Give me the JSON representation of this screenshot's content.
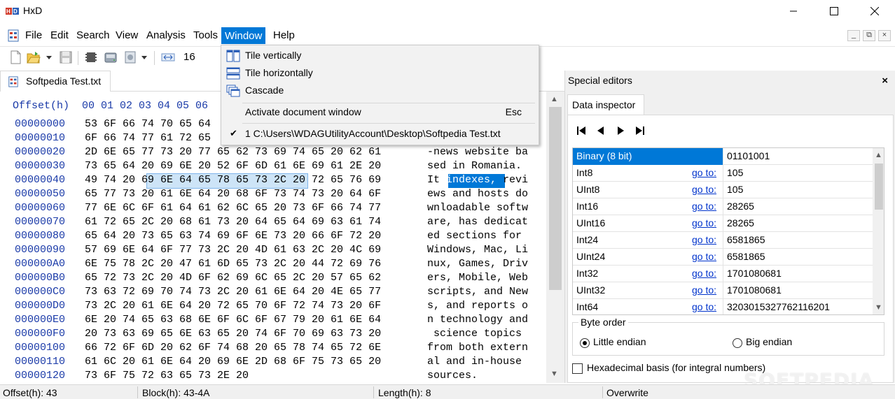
{
  "window": {
    "title": "HxD",
    "minimize_icon": "minimize-icon",
    "maximize_icon": "maximize-icon",
    "close_icon": "close-icon"
  },
  "menu": {
    "items": [
      "File",
      "Edit",
      "Search",
      "View",
      "Analysis",
      "Tools",
      "Window",
      "Help"
    ],
    "active": "Window",
    "mdi_buttons": [
      "_",
      "⧉",
      "×"
    ]
  },
  "toolbar": {
    "icons": [
      "new-file-icon",
      "open-file-icon",
      "dropdown-arrow-icon",
      "save-icon",
      "ram-icon",
      "disk-icon",
      "disk-image-icon",
      "dropdown-arrow-icon",
      "bytes-per-row-icon"
    ],
    "bytes_per_row": "16"
  },
  "document_tab": {
    "label": "Softpedia Test.txt"
  },
  "window_menu": {
    "items": [
      {
        "label": "Tile vertically",
        "icon": "tile-vertical-icon"
      },
      {
        "label": "Tile horizontally",
        "icon": "tile-horizontal-icon"
      },
      {
        "label": "Cascade",
        "icon": "cascade-icon"
      }
    ],
    "activate_label": "Activate document window",
    "activate_shortcut": "Esc",
    "document_entry": "1 C:\\Users\\WDAGUtilityAccount\\Desktop\\Softpedia Test.txt",
    "document_checked": true
  },
  "hex": {
    "header": "Offset(h)  00 01 02 03 04 05 06",
    "rows": [
      {
        "offset": "00000000",
        "bytes": "53 6F 66 74 70 65 64",
        "ascii": ""
      },
      {
        "offset": "00000010",
        "bytes": "6F 66 74 77 61 72 65",
        "ascii": ""
      },
      {
        "offset": "00000020",
        "bytes": "2D 6E 65 77 73 20 77 65 62 73 69 74 65 20 62 61",
        "ascii": "-news website ba"
      },
      {
        "offset": "00000030",
        "bytes": "73 65 64 20 69 6E 20 52 6F 6D 61 6E 69 61 2E 20",
        "ascii": "sed in Romania. "
      },
      {
        "offset": "00000040",
        "bytes": "49 74 20 69 6E 64 65 78 65 73 2C 20 72 65 76 69",
        "ascii": "It indexes, revi"
      },
      {
        "offset": "00000050",
        "bytes": "65 77 73 20 61 6E 64 20 68 6F 73 74 73 20 64 6F",
        "ascii": "ews and hosts do"
      },
      {
        "offset": "00000060",
        "bytes": "77 6E 6C 6F 61 64 61 62 6C 65 20 73 6F 66 74 77",
        "ascii": "wnloadable softw"
      },
      {
        "offset": "00000070",
        "bytes": "61 72 65 2C 20 68 61 73 20 64 65 64 69 63 61 74",
        "ascii": "are, has dedicat"
      },
      {
        "offset": "00000080",
        "bytes": "65 64 20 73 65 63 74 69 6F 6E 73 20 66 6F 72 20",
        "ascii": "ed sections for "
      },
      {
        "offset": "00000090",
        "bytes": "57 69 6E 64 6F 77 73 2C 20 4D 61 63 2C 20 4C 69",
        "ascii": "Windows, Mac, Li"
      },
      {
        "offset": "000000A0",
        "bytes": "6E 75 78 2C 20 47 61 6D 65 73 2C 20 44 72 69 76",
        "ascii": "nux, Games, Driv"
      },
      {
        "offset": "000000B0",
        "bytes": "65 72 73 2C 20 4D 6F 62 69 6C 65 2C 20 57 65 62",
        "ascii": "ers, Mobile, Web"
      },
      {
        "offset": "000000C0",
        "bytes": "73 63 72 69 70 74 73 2C 20 61 6E 64 20 4E 65 77",
        "ascii": "scripts, and New"
      },
      {
        "offset": "000000D0",
        "bytes": "73 2C 20 61 6E 64 20 72 65 70 6F 72 74 73 20 6F",
        "ascii": "s, and reports o"
      },
      {
        "offset": "000000E0",
        "bytes": "6E 20 74 65 63 68 6E 6F 6C 6F 67 79 20 61 6E 64",
        "ascii": "n technology and"
      },
      {
        "offset": "000000F0",
        "bytes": "20 73 63 69 65 6E 63 65 20 74 6F 70 69 63 73 20",
        "ascii": " science topics "
      },
      {
        "offset": "00000100",
        "bytes": "66 72 6F 6D 20 62 6F 74 68 20 65 78 74 65 72 6E",
        "ascii": "from both extern"
      },
      {
        "offset": "00000110",
        "bytes": "61 6C 20 61 6E 64 20 69 6E 2D 68 6F 75 73 65 20",
        "ascii": "al and in-house "
      },
      {
        "offset": "00000120",
        "bytes": "73 6F 75 72 63 65 73 2E 20",
        "ascii": "sources."
      }
    ]
  },
  "panel": {
    "title": "Special editors",
    "close": "×",
    "tab": "Data inspector",
    "nav_icons": [
      "first-icon",
      "previous-icon",
      "next-icon",
      "last-icon"
    ],
    "rows": [
      {
        "type": "Binary (8 bit)",
        "goto": "",
        "value": "01101001",
        "selected": true
      },
      {
        "type": "Int8",
        "goto": "go to:",
        "value": "105"
      },
      {
        "type": "UInt8",
        "goto": "go to:",
        "value": "105"
      },
      {
        "type": "Int16",
        "goto": "go to:",
        "value": "28265"
      },
      {
        "type": "UInt16",
        "goto": "go to:",
        "value": "28265"
      },
      {
        "type": "Int24",
        "goto": "go to:",
        "value": "6581865"
      },
      {
        "type": "UInt24",
        "goto": "go to:",
        "value": "6581865"
      },
      {
        "type": "Int32",
        "goto": "go to:",
        "value": "1701080681"
      },
      {
        "type": "UInt32",
        "goto": "go to:",
        "value": "1701080681"
      },
      {
        "type": "Int64",
        "goto": "go to:",
        "value": "3203015327762116201"
      }
    ],
    "byte_order_title": "Byte order",
    "little_endian": "Little endian",
    "big_endian": "Big endian",
    "little_endian_selected": true,
    "hex_basis": "Hexadecimal basis (for integral numbers)",
    "hex_basis_checked": false
  },
  "watermark": "SOFTPEDIA",
  "status": {
    "offset": "Offset(h): 43",
    "block": "Block(h): 43-4A",
    "length": "Length(h): 8",
    "mode": "Overwrite"
  }
}
